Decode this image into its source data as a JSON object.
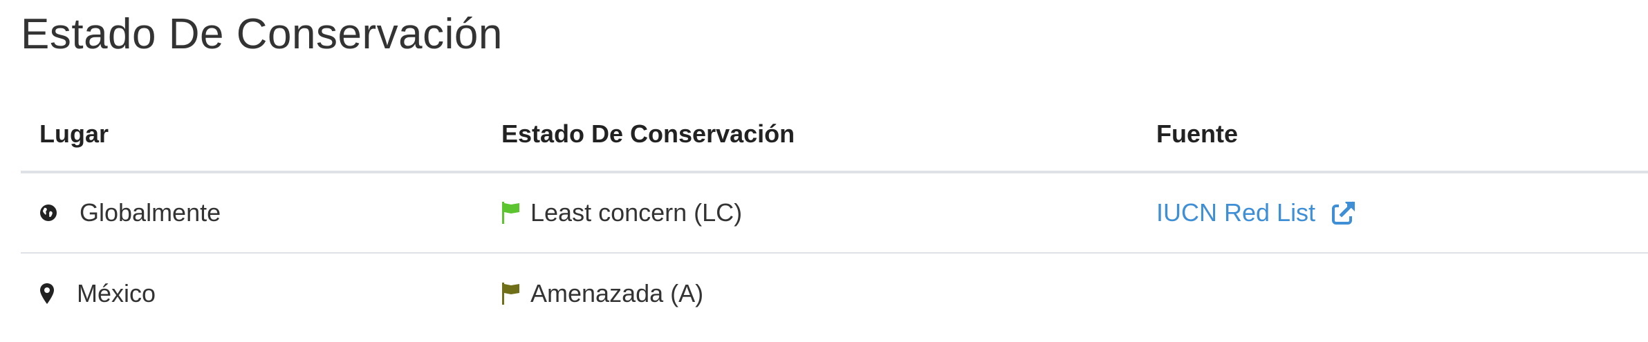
{
  "section": {
    "title": "Estado De Conservación"
  },
  "table": {
    "headers": [
      "Lugar",
      "Estado De Conservación",
      "Fuente"
    ],
    "rows": [
      {
        "place_icon": "globe-icon",
        "place": "Globalmente",
        "status_icon": "flag-icon",
        "status_color": "#5cc42f",
        "status": "Least concern (LC)",
        "source": "IUCN Red List",
        "source_icon": "external-link-icon"
      },
      {
        "place_icon": "map-pin-icon",
        "place": "México",
        "status_icon": "flag-icon",
        "status_color": "#6f6f17",
        "status": "Amenazada (A)",
        "source": ""
      }
    ]
  },
  "colors": {
    "link": "#3f8fd6",
    "divider": "#dee2e6"
  }
}
